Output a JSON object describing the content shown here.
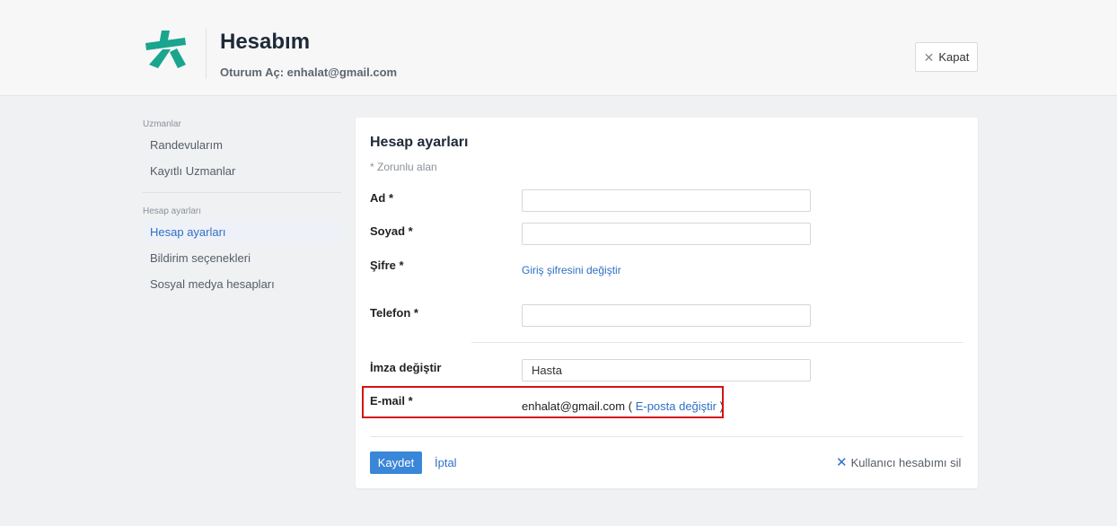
{
  "header": {
    "title": "Hesabım",
    "login_info": "Oturum Aç: enhalat@gmail.com",
    "close_label": "Kapat",
    "brand_color": "#1aa58f"
  },
  "sidebar": {
    "sections": [
      {
        "title": "Uzmanlar",
        "items": [
          "Randevularım",
          "Kayıtlı Uzmanlar"
        ]
      },
      {
        "title": "Hesap ayarları",
        "items": [
          "Hesap ayarları",
          "Bildirim seçenekleri",
          "Sosyal medya hesapları"
        ]
      }
    ],
    "active_item": "Hesap ayarları"
  },
  "form": {
    "title": "Hesap ayarları",
    "required_note": "* Zorunlu alan",
    "fields": {
      "first_name": {
        "label": "Ad *",
        "value": ""
      },
      "last_name": {
        "label": "Soyad *",
        "value": ""
      },
      "password": {
        "label": "Şifre *",
        "link": "Giriş şifresini değiştir"
      },
      "phone": {
        "label": "Telefon *",
        "value": ""
      },
      "signature": {
        "label": "İmza değiştir",
        "value": "Hasta"
      },
      "email": {
        "label": "E-mail *",
        "value": "enhalat@gmail.com",
        "open": "(",
        "link": "E-posta değiştir",
        "close": ")"
      }
    },
    "save_label": "Kaydet",
    "cancel_label": "İptal",
    "delete_label": "Kullanıcı hesabımı sil",
    "accent_color": "#3a86d8",
    "highlight_color": "#d41414"
  }
}
